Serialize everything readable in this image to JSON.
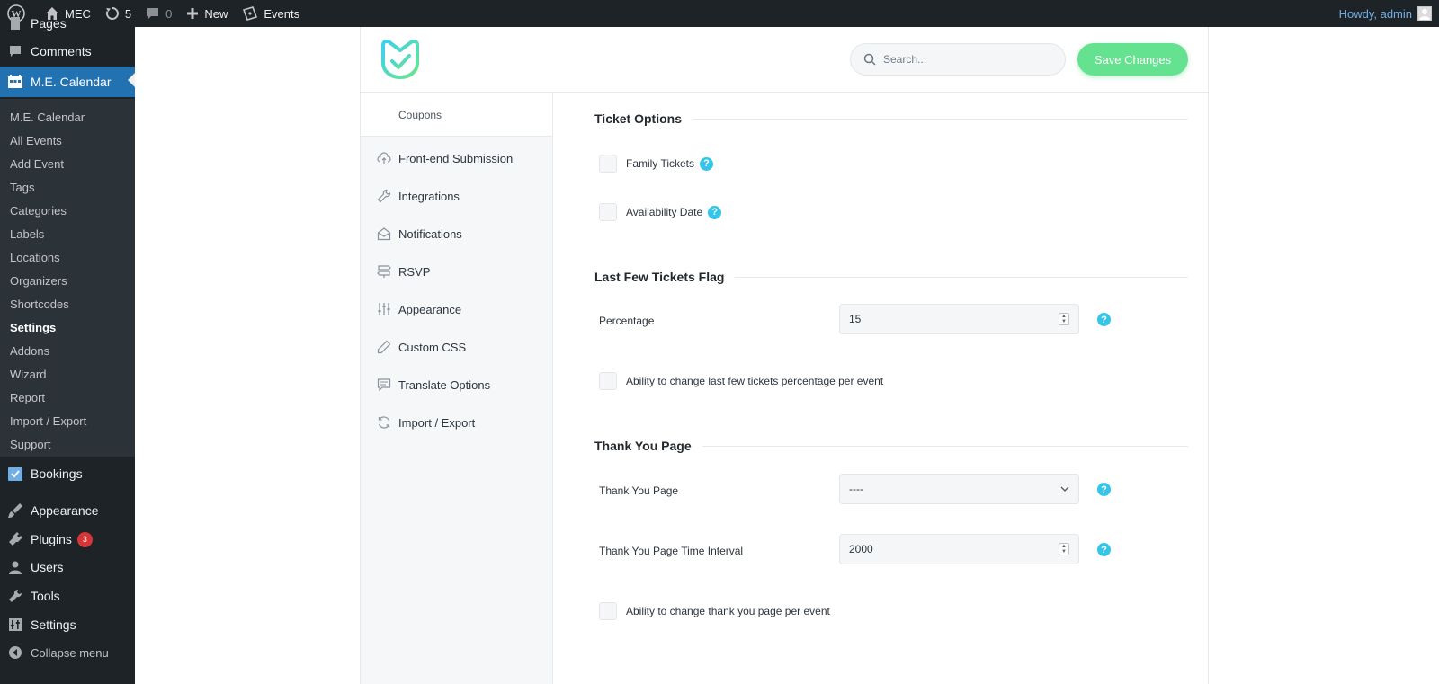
{
  "adminbar": {
    "site_name": "MEC",
    "updates_count": "5",
    "comments_count": "0",
    "new_label": "New",
    "events_label": "Events",
    "howdy": "Howdy, admin"
  },
  "adminmenu": {
    "top_partial": "Pages",
    "comments": "Comments",
    "mecalendar": "M.E. Calendar",
    "submenu": [
      "M.E. Calendar",
      "All Events",
      "Add Event",
      "Tags",
      "Categories",
      "Labels",
      "Locations",
      "Organizers",
      "Shortcodes",
      "Settings",
      "Addons",
      "Wizard",
      "Report",
      "Import / Export",
      "Support"
    ],
    "current_sub": "Settings",
    "bookings": "Bookings",
    "appearance": "Appearance",
    "plugins": "Plugins",
    "plugins_badge": "3",
    "users": "Users",
    "tools": "Tools",
    "settings": "Settings",
    "collapse": "Collapse menu"
  },
  "header": {
    "search_placeholder": "Search...",
    "save_label": "Save Changes"
  },
  "nav": {
    "top_item": "Coupons",
    "items": [
      {
        "label": "Front-end Submission",
        "icon": "cloud-upload-icon"
      },
      {
        "label": "Integrations",
        "icon": "wrench-icon"
      },
      {
        "label": "Notifications",
        "icon": "envelope-open-icon"
      },
      {
        "label": "RSVP",
        "icon": "signpost-icon"
      },
      {
        "label": "Appearance",
        "icon": "sliders-icon"
      },
      {
        "label": "Custom CSS",
        "icon": "pencil-icon"
      },
      {
        "label": "Translate Options",
        "icon": "comment-icon"
      },
      {
        "label": "Import / Export",
        "icon": "refresh-icon"
      }
    ]
  },
  "content": {
    "ticket_options": {
      "title": "Ticket Options",
      "family_tickets": "Family Tickets",
      "availability_date": "Availability Date"
    },
    "last_few": {
      "title": "Last Few Tickets Flag",
      "percentage_label": "Percentage",
      "percentage_value": "15",
      "per_event_label": "Ability to change last few tickets percentage per event"
    },
    "thank_you": {
      "title": "Thank You Page",
      "page_label": "Thank You Page",
      "page_value": "----",
      "interval_label": "Thank You Page Time Interval",
      "interval_value": "2000",
      "per_event_label": "Ability to change thank you page per event"
    },
    "help_glyph": "?"
  },
  "colors": {
    "admin_dark": "#1d2327",
    "admin_blue": "#2271b1",
    "save_green": "#64e28f",
    "help_cyan": "#35c5e8"
  }
}
